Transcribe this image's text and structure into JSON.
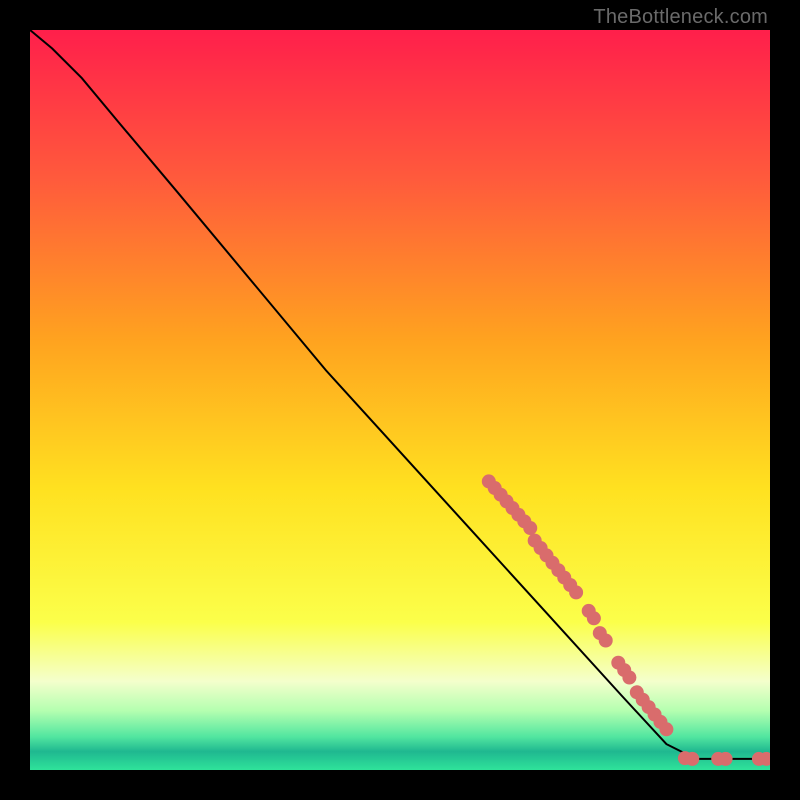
{
  "watermark": "TheBottleneck.com",
  "chart_data": {
    "type": "line",
    "title": "",
    "xlabel": "",
    "ylabel": "",
    "xlim": [
      0,
      100
    ],
    "ylim": [
      0,
      100
    ],
    "gradient_stops": [
      {
        "offset": 0.0,
        "color": "#ff1f4b"
      },
      {
        "offset": 0.2,
        "color": "#ff5a3c"
      },
      {
        "offset": 0.42,
        "color": "#ffa31f"
      },
      {
        "offset": 0.62,
        "color": "#ffe120"
      },
      {
        "offset": 0.8,
        "color": "#fbff4a"
      },
      {
        "offset": 0.88,
        "color": "#f4ffcc"
      },
      {
        "offset": 0.92,
        "color": "#b4ffb0"
      },
      {
        "offset": 0.955,
        "color": "#52e6a0"
      },
      {
        "offset": 0.975,
        "color": "#1fb890"
      },
      {
        "offset": 1.0,
        "color": "#2fe39a"
      }
    ],
    "series": [
      {
        "name": "curve",
        "type": "line",
        "color": "#000000",
        "points": [
          {
            "x": 0.0,
            "y": 100.0
          },
          {
            "x": 3.0,
            "y": 97.5
          },
          {
            "x": 7.0,
            "y": 93.5
          },
          {
            "x": 12.0,
            "y": 87.5
          },
          {
            "x": 20.0,
            "y": 78.0
          },
          {
            "x": 30.0,
            "y": 66.0
          },
          {
            "x": 40.0,
            "y": 54.0
          },
          {
            "x": 50.0,
            "y": 43.0
          },
          {
            "x": 60.0,
            "y": 32.0
          },
          {
            "x": 70.0,
            "y": 21.0
          },
          {
            "x": 80.0,
            "y": 10.0
          },
          {
            "x": 86.0,
            "y": 3.5
          },
          {
            "x": 90.0,
            "y": 1.5
          },
          {
            "x": 100.0,
            "y": 1.5
          }
        ]
      },
      {
        "name": "markers",
        "type": "scatter",
        "color": "#d96c6c",
        "radius": 7,
        "points": [
          {
            "x": 62.0,
            "y": 39.0
          },
          {
            "x": 62.8,
            "y": 38.1
          },
          {
            "x": 63.6,
            "y": 37.2
          },
          {
            "x": 64.4,
            "y": 36.3
          },
          {
            "x": 65.2,
            "y": 35.4
          },
          {
            "x": 66.0,
            "y": 34.5
          },
          {
            "x": 66.8,
            "y": 33.6
          },
          {
            "x": 67.6,
            "y": 32.7
          },
          {
            "x": 68.2,
            "y": 31.0
          },
          {
            "x": 69.0,
            "y": 30.0
          },
          {
            "x": 69.8,
            "y": 29.0
          },
          {
            "x": 70.6,
            "y": 28.0
          },
          {
            "x": 71.4,
            "y": 27.0
          },
          {
            "x": 72.2,
            "y": 26.0
          },
          {
            "x": 73.0,
            "y": 25.0
          },
          {
            "x": 73.8,
            "y": 24.0
          },
          {
            "x": 75.5,
            "y": 21.5
          },
          {
            "x": 76.2,
            "y": 20.5
          },
          {
            "x": 77.0,
            "y": 18.5
          },
          {
            "x": 77.8,
            "y": 17.5
          },
          {
            "x": 79.5,
            "y": 14.5
          },
          {
            "x": 80.3,
            "y": 13.5
          },
          {
            "x": 81.0,
            "y": 12.5
          },
          {
            "x": 82.0,
            "y": 10.5
          },
          {
            "x": 82.8,
            "y": 9.5
          },
          {
            "x": 83.6,
            "y": 8.5
          },
          {
            "x": 84.4,
            "y": 7.5
          },
          {
            "x": 85.2,
            "y": 6.5
          },
          {
            "x": 86.0,
            "y": 5.5
          },
          {
            "x": 88.5,
            "y": 1.6
          },
          {
            "x": 89.5,
            "y": 1.5
          },
          {
            "x": 93.0,
            "y": 1.5
          },
          {
            "x": 94.0,
            "y": 1.5
          },
          {
            "x": 98.5,
            "y": 1.5
          },
          {
            "x": 99.5,
            "y": 1.5
          }
        ]
      }
    ]
  }
}
